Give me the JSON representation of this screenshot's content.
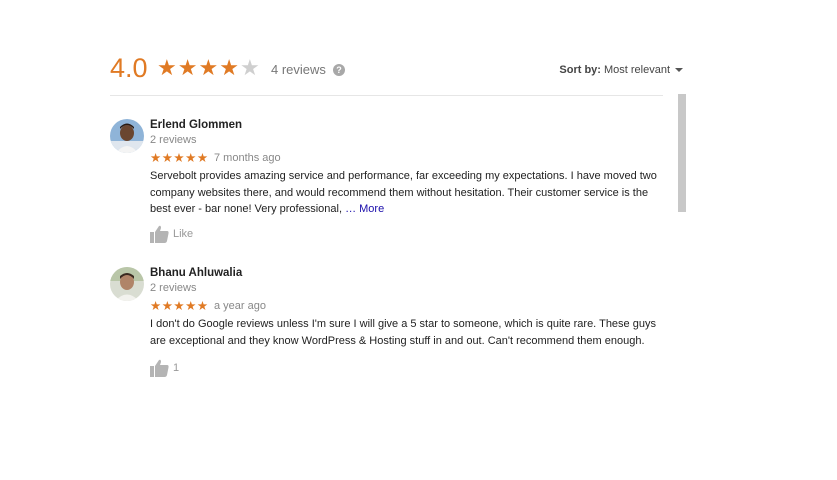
{
  "summary": {
    "rating": "4.0",
    "stars": 4,
    "max_stars": 5,
    "review_count": "4 reviews",
    "help_icon": "?"
  },
  "sort": {
    "label": "Sort by:",
    "value": "Most relevant"
  },
  "colors": {
    "accent": "#e07a24",
    "link": "#1a0dab",
    "muted": "#888888"
  },
  "reviews": [
    {
      "author": "Erlend Glommen",
      "meta": "2 reviews",
      "stars": "★★★★★",
      "date": "7 months ago",
      "text": "Servebolt provides amazing service and performance, far exceeding my expectations. I have moved two company websites there, and would recommend them without hesitation. Their customer service is the best ever - bar none! Very professional, ",
      "ellipsis": "…",
      "more": "More",
      "like_label": "Like"
    },
    {
      "author": "Bhanu Ahluwalia",
      "meta": "2 reviews",
      "stars": "★★★★★",
      "date": "a year ago",
      "text": "I don't do Google reviews unless I'm sure I will give a 5 star to someone, which is quite rare. These guys are exceptional and they know WordPress & Hosting stuff in and out. Can't recommend them enough.",
      "like_label": "1"
    }
  ]
}
